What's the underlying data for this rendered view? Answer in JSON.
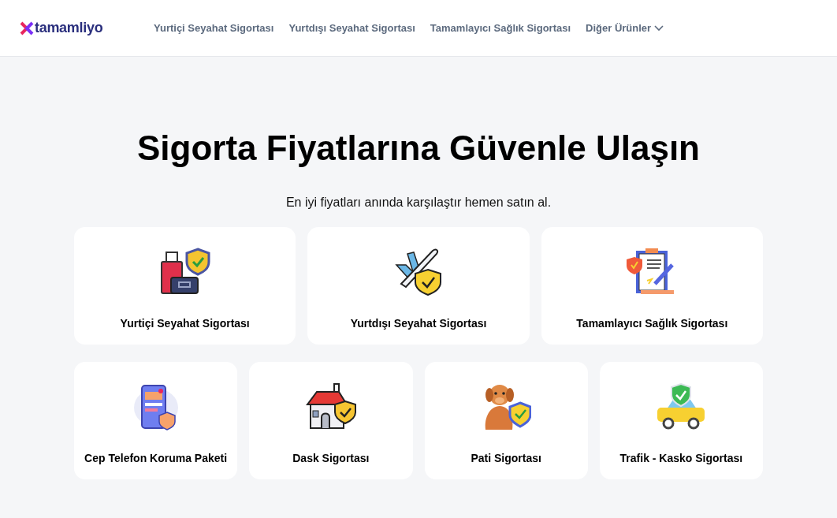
{
  "header": {
    "logo_text": "tamamliyo",
    "nav": [
      {
        "label": "Yurtiçi Seyahat Sigortası",
        "kind": "link"
      },
      {
        "label": "Yurtdışı Seyahat Sigortası",
        "kind": "link"
      },
      {
        "label": "Tamamlayıcı Sağlık Sigortası",
        "kind": "link"
      },
      {
        "label": "Diğer Ürünler",
        "kind": "dropdown"
      }
    ]
  },
  "hero": {
    "title": "Sigorta Fiyatlarına Güvenle Ulaşın",
    "subtitle": "En iyi fiyatları anında karşılaştır hemen satın al."
  },
  "product_rows": [
    [
      {
        "label": "Yurtiçi Seyahat Sigortası",
        "kind": "luggage"
      },
      {
        "label": "Yurtdışı Seyahat Sigortası",
        "kind": "plane"
      },
      {
        "label": "Tamamlayıcı Sağlık Sigortası",
        "kind": "clipboard"
      }
    ],
    [
      {
        "label": "Cep Telefon Koruma Paketi",
        "kind": "phone"
      },
      {
        "label": "Dask Sigortası",
        "kind": "house"
      },
      {
        "label": "Pati Sigortası",
        "kind": "dog"
      },
      {
        "label": "Trafik - Kasko Sigortası",
        "kind": "car"
      }
    ]
  ]
}
